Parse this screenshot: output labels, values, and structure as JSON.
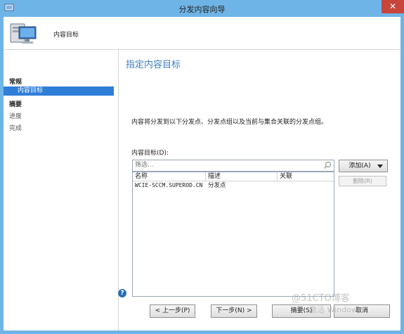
{
  "window": {
    "title": "分发内容向导",
    "close_glyph": "✕"
  },
  "header": {
    "label": "内容目标"
  },
  "nav": {
    "items": [
      {
        "label": "常规"
      },
      {
        "label": "内容目标"
      },
      {
        "label": "摘要"
      },
      {
        "label": "进度"
      },
      {
        "label": "完成"
      }
    ]
  },
  "main": {
    "title": "指定内容目标",
    "description": "内容将分发到以下分发点、分发点组以及当前与集合关联的分发点组。",
    "list_label": "内容目标(D):",
    "filter_placeholder": "筛选...",
    "columns": [
      "名称",
      "描述",
      "关联"
    ],
    "rows": [
      {
        "name": "WCIE-SCCM.SUPEROD.CN",
        "desc": "分发点",
        "assoc": ""
      }
    ],
    "add_button": "添加(A)",
    "remove_button": "删除(R)"
  },
  "footer": {
    "help_glyph": "?",
    "back": "< 上一步(P)",
    "next": "下一步(N) >",
    "summary": "摘要(S)",
    "cancel": "取消"
  },
  "watermark": {
    "line1": "@51CTO博客",
    "line2": "激活 Windows"
  },
  "colors": {
    "titlebar": "#6fb4e6",
    "close": "#c7453b",
    "accent": "#2f7ed8",
    "title_text": "#3b7dc4"
  },
  "icons": {
    "window": "wizard-icon",
    "header": "computer-icon",
    "filter": "search-icon",
    "dropdown": "chevron-down-icon",
    "help": "help-icon"
  }
}
